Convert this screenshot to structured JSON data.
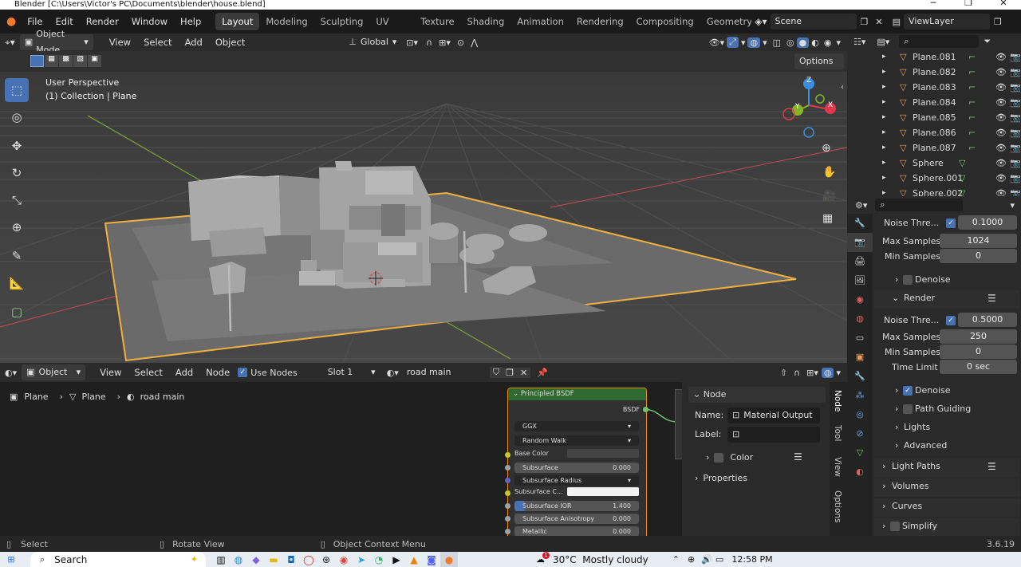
{
  "window": {
    "title": "Blender [C:\\Users\\Victor's PC\\Documents\\blender\\house.blend]"
  },
  "menu": [
    "File",
    "Edit",
    "Render",
    "Window",
    "Help"
  ],
  "workspaces": [
    "Layout",
    "Modeling",
    "Sculpting",
    "UV Editing",
    "Texture Paint",
    "Shading",
    "Animation",
    "Rendering",
    "Compositing",
    "Geometry Noc"
  ],
  "scene": {
    "label": "Scene",
    "view_layer": "ViewLayer"
  },
  "viewport": {
    "mode": "Object Mode",
    "menus": [
      "View",
      "Select",
      "Add",
      "Object"
    ],
    "transform": "Global",
    "options": "Options",
    "info_line1": "User Perspective",
    "info_line2": "(1) Collection | Plane",
    "gizmo": {
      "x": "X",
      "y": "Y",
      "z": "Z"
    }
  },
  "node_editor": {
    "type": "Object",
    "menus": [
      "View",
      "Select",
      "Add",
      "Node"
    ],
    "use_nodes": "Use Nodes",
    "slot": "Slot 1",
    "material": "road main",
    "breadcrumb": [
      "Plane",
      "Plane",
      "road main"
    ],
    "bsdf": {
      "title": "Principled BSDF",
      "output": "BSDF",
      "distribution": "GGX",
      "subsurface_method": "Random Walk",
      "base_color": "Base Color",
      "subsurface": {
        "label": "Subsurface",
        "value": "0.000"
      },
      "radius": "Subsurface Radius",
      "subsurface_color": "Subsurface C...",
      "ior": {
        "label": "Subsurface IOR",
        "value": "1.400"
      },
      "anisotropy": {
        "label": "Subsurface Anisotropy",
        "value": "0.000"
      },
      "metallic": {
        "label": "Metallic",
        "value": "0.000"
      }
    },
    "sidebar": {
      "section": "Node",
      "name_label": "Name:",
      "name_value": "Material Output",
      "label_label": "Label:",
      "color": "Color",
      "properties": "Properties"
    },
    "tabs": [
      "Node",
      "Tool",
      "View",
      "Options"
    ]
  },
  "outliner": {
    "items": [
      "Plane.081",
      "Plane.082",
      "Plane.083",
      "Plane.084",
      "Plane.085",
      "Plane.086",
      "Plane.087",
      "Sphere",
      "Sphere.001",
      "Sphere.002"
    ]
  },
  "properties": {
    "viewport_noise": {
      "label": "Noise Thre...",
      "value": "0.1000"
    },
    "viewport_max": {
      "label": "Max Samples",
      "value": "1024"
    },
    "viewport_min": {
      "label": "Min Samples",
      "value": "0"
    },
    "denoise_sub": "Denoise",
    "render_header": "Render",
    "render_noise": {
      "label": "Noise Thre...",
      "value": "0.5000"
    },
    "render_max": {
      "label": "Max Samples",
      "value": "250"
    },
    "render_min": {
      "label": "Min Samples",
      "value": "0"
    },
    "time_limit": {
      "label": "Time Limit",
      "value": "0 sec"
    },
    "denoise": "Denoise",
    "path_guiding": "Path Guiding",
    "lights": "Lights",
    "advanced": "Advanced",
    "light_paths": "Light Paths",
    "volumes": "Volumes",
    "curves": "Curves",
    "simplify": "Simplify"
  },
  "status": {
    "select": "Select",
    "rotate": "Rotate View",
    "context": "Object Context Menu",
    "version": "3.6.19"
  },
  "taskbar": {
    "search": "Search",
    "weather": "30°C  Mostly cloudy",
    "time": "12:58 PM",
    "badge": "1"
  },
  "colors": {
    "accent": "#4772b3",
    "selection": "#f0b040",
    "node_header": "#2f6a33",
    "x_axis": "#e0394e",
    "y_axis": "#84b624",
    "z_axis": "#3a8de0"
  }
}
